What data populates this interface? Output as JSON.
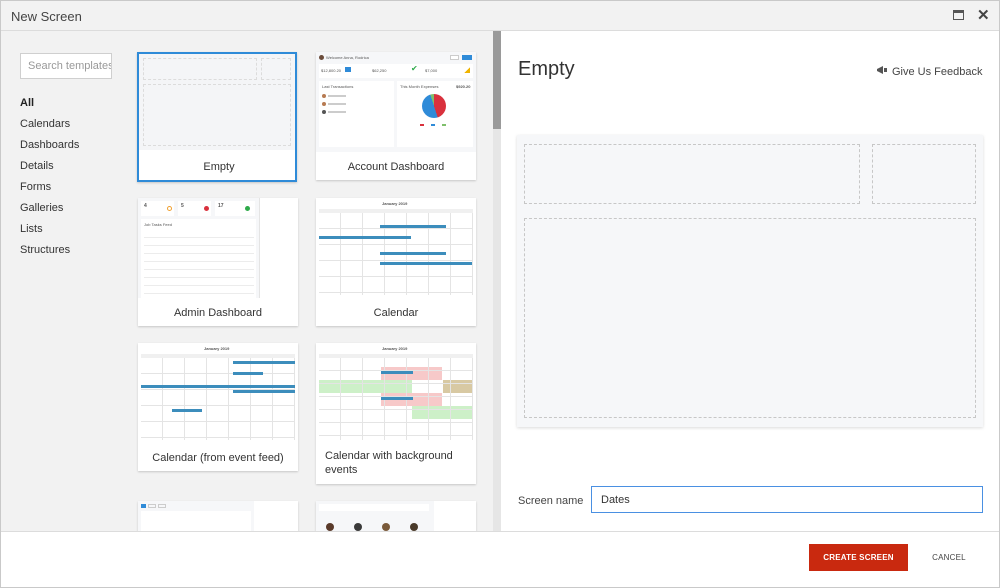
{
  "window": {
    "title": "New Screen"
  },
  "search": {
    "placeholder": "Search templates"
  },
  "categories": [
    "All",
    "Calendars",
    "Dashboards",
    "Details",
    "Forms",
    "Galleries",
    "Lists",
    "Structures"
  ],
  "templates": [
    {
      "label": "Empty"
    },
    {
      "label": "Account Dashboard"
    },
    {
      "label": "Admin Dashboard"
    },
    {
      "label": "Calendar"
    },
    {
      "label": "Calendar (from event feed)"
    },
    {
      "label": "Calendar with background events"
    }
  ],
  "thumbs": {
    "account": {
      "welcome": "Welcome Anna, Rodrica",
      "amount1": "$12,800.20",
      "amount2": "$62,250",
      "amount3": "$7,000",
      "last_tx": "Last Transactions",
      "expenses": "This Month Expenses",
      "total": "$920.20"
    },
    "admin": {
      "n1": "4",
      "n2": "5",
      "n3": "17",
      "list_title": "Job Tasks Feed"
    },
    "calendar": {
      "month": "January 2019",
      "days": [
        "Sun",
        "Mon",
        "Tue",
        "Wed",
        "Thu",
        "Fri",
        "Sat"
      ]
    },
    "cal_feed": {
      "month": "January 2019"
    },
    "cal_bg": {
      "month": "January 2019"
    }
  },
  "preview": {
    "title": "Empty",
    "feedback": "Give Us Feedback"
  },
  "screen_name": {
    "label": "Screen name",
    "value": "Dates"
  },
  "footer": {
    "create": "CREATE SCREEN",
    "cancel": "CANCEL"
  },
  "colors": {
    "accent": "#2f8bd8",
    "create_button": "#c9290f",
    "event_bar": "#3c8dbc",
    "bg_pink": "#f7c9c9",
    "bg_green": "#cdf0c8",
    "bg_tan": "#d8c9a3"
  }
}
